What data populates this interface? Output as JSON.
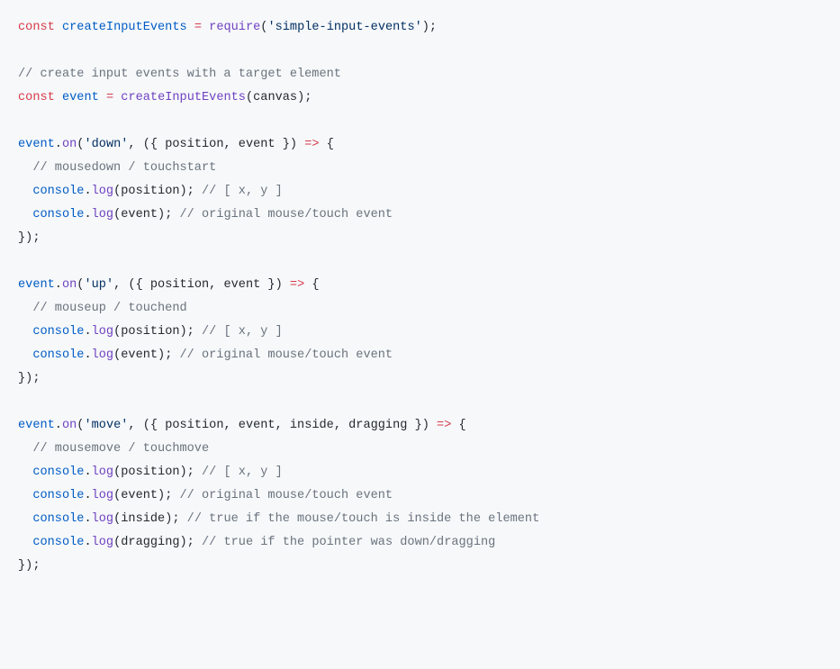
{
  "code": {
    "lines": [
      [
        {
          "cls": "c-key",
          "t": "const"
        },
        {
          "cls": "c-plain",
          "t": " "
        },
        {
          "cls": "c-const",
          "t": "createInputEvents"
        },
        {
          "cls": "c-plain",
          "t": " "
        },
        {
          "cls": "c-key",
          "t": "="
        },
        {
          "cls": "c-plain",
          "t": " "
        },
        {
          "cls": "c-func",
          "t": "require"
        },
        {
          "cls": "c-plain",
          "t": "("
        },
        {
          "cls": "c-str",
          "t": "'simple-input-events'"
        },
        {
          "cls": "c-plain",
          "t": ");"
        }
      ],
      [],
      [
        {
          "cls": "c-com",
          "t": "// create input events with a target element"
        }
      ],
      [
        {
          "cls": "c-key",
          "t": "const"
        },
        {
          "cls": "c-plain",
          "t": " "
        },
        {
          "cls": "c-const",
          "t": "event"
        },
        {
          "cls": "c-plain",
          "t": " "
        },
        {
          "cls": "c-key",
          "t": "="
        },
        {
          "cls": "c-plain",
          "t": " "
        },
        {
          "cls": "c-func",
          "t": "createInputEvents"
        },
        {
          "cls": "c-plain",
          "t": "(canvas);"
        }
      ],
      [],
      [
        {
          "cls": "c-const",
          "t": "event"
        },
        {
          "cls": "c-plain",
          "t": "."
        },
        {
          "cls": "c-func",
          "t": "on"
        },
        {
          "cls": "c-plain",
          "t": "("
        },
        {
          "cls": "c-str",
          "t": "'down'"
        },
        {
          "cls": "c-plain",
          "t": ", ({ position, event }) "
        },
        {
          "cls": "c-key",
          "t": "=>"
        },
        {
          "cls": "c-plain",
          "t": " {"
        }
      ],
      [
        {
          "cls": "c-plain",
          "t": "  "
        },
        {
          "cls": "c-com",
          "t": "// mousedown / touchstart"
        }
      ],
      [
        {
          "cls": "c-plain",
          "t": "  "
        },
        {
          "cls": "c-const",
          "t": "console"
        },
        {
          "cls": "c-plain",
          "t": "."
        },
        {
          "cls": "c-func",
          "t": "log"
        },
        {
          "cls": "c-plain",
          "t": "(position); "
        },
        {
          "cls": "c-com",
          "t": "// [ x, y ]"
        }
      ],
      [
        {
          "cls": "c-plain",
          "t": "  "
        },
        {
          "cls": "c-const",
          "t": "console"
        },
        {
          "cls": "c-plain",
          "t": "."
        },
        {
          "cls": "c-func",
          "t": "log"
        },
        {
          "cls": "c-plain",
          "t": "(event); "
        },
        {
          "cls": "c-com",
          "t": "// original mouse/touch event"
        }
      ],
      [
        {
          "cls": "c-plain",
          "t": "});"
        }
      ],
      [],
      [
        {
          "cls": "c-const",
          "t": "event"
        },
        {
          "cls": "c-plain",
          "t": "."
        },
        {
          "cls": "c-func",
          "t": "on"
        },
        {
          "cls": "c-plain",
          "t": "("
        },
        {
          "cls": "c-str",
          "t": "'up'"
        },
        {
          "cls": "c-plain",
          "t": ", ({ position, event }) "
        },
        {
          "cls": "c-key",
          "t": "=>"
        },
        {
          "cls": "c-plain",
          "t": " {"
        }
      ],
      [
        {
          "cls": "c-plain",
          "t": "  "
        },
        {
          "cls": "c-com",
          "t": "// mouseup / touchend"
        }
      ],
      [
        {
          "cls": "c-plain",
          "t": "  "
        },
        {
          "cls": "c-const",
          "t": "console"
        },
        {
          "cls": "c-plain",
          "t": "."
        },
        {
          "cls": "c-func",
          "t": "log"
        },
        {
          "cls": "c-plain",
          "t": "(position); "
        },
        {
          "cls": "c-com",
          "t": "// [ x, y ]"
        }
      ],
      [
        {
          "cls": "c-plain",
          "t": "  "
        },
        {
          "cls": "c-const",
          "t": "console"
        },
        {
          "cls": "c-plain",
          "t": "."
        },
        {
          "cls": "c-func",
          "t": "log"
        },
        {
          "cls": "c-plain",
          "t": "(event); "
        },
        {
          "cls": "c-com",
          "t": "// original mouse/touch event"
        }
      ],
      [
        {
          "cls": "c-plain",
          "t": "});"
        }
      ],
      [],
      [
        {
          "cls": "c-const",
          "t": "event"
        },
        {
          "cls": "c-plain",
          "t": "."
        },
        {
          "cls": "c-func",
          "t": "on"
        },
        {
          "cls": "c-plain",
          "t": "("
        },
        {
          "cls": "c-str",
          "t": "'move'"
        },
        {
          "cls": "c-plain",
          "t": ", ({ position, event, inside, dragging }) "
        },
        {
          "cls": "c-key",
          "t": "=>"
        },
        {
          "cls": "c-plain",
          "t": " {"
        }
      ],
      [
        {
          "cls": "c-plain",
          "t": "  "
        },
        {
          "cls": "c-com",
          "t": "// mousemove / touchmove"
        }
      ],
      [
        {
          "cls": "c-plain",
          "t": "  "
        },
        {
          "cls": "c-const",
          "t": "console"
        },
        {
          "cls": "c-plain",
          "t": "."
        },
        {
          "cls": "c-func",
          "t": "log"
        },
        {
          "cls": "c-plain",
          "t": "(position); "
        },
        {
          "cls": "c-com",
          "t": "// [ x, y ]"
        }
      ],
      [
        {
          "cls": "c-plain",
          "t": "  "
        },
        {
          "cls": "c-const",
          "t": "console"
        },
        {
          "cls": "c-plain",
          "t": "."
        },
        {
          "cls": "c-func",
          "t": "log"
        },
        {
          "cls": "c-plain",
          "t": "(event); "
        },
        {
          "cls": "c-com",
          "t": "// original mouse/touch event"
        }
      ],
      [
        {
          "cls": "c-plain",
          "t": "  "
        },
        {
          "cls": "c-const",
          "t": "console"
        },
        {
          "cls": "c-plain",
          "t": "."
        },
        {
          "cls": "c-func",
          "t": "log"
        },
        {
          "cls": "c-plain",
          "t": "(inside); "
        },
        {
          "cls": "c-com",
          "t": "// true if the mouse/touch is inside the element"
        }
      ],
      [
        {
          "cls": "c-plain",
          "t": "  "
        },
        {
          "cls": "c-const",
          "t": "console"
        },
        {
          "cls": "c-plain",
          "t": "."
        },
        {
          "cls": "c-func",
          "t": "log"
        },
        {
          "cls": "c-plain",
          "t": "(dragging); "
        },
        {
          "cls": "c-com",
          "t": "// true if the pointer was down/dragging"
        }
      ],
      [
        {
          "cls": "c-plain",
          "t": "});"
        }
      ]
    ]
  }
}
